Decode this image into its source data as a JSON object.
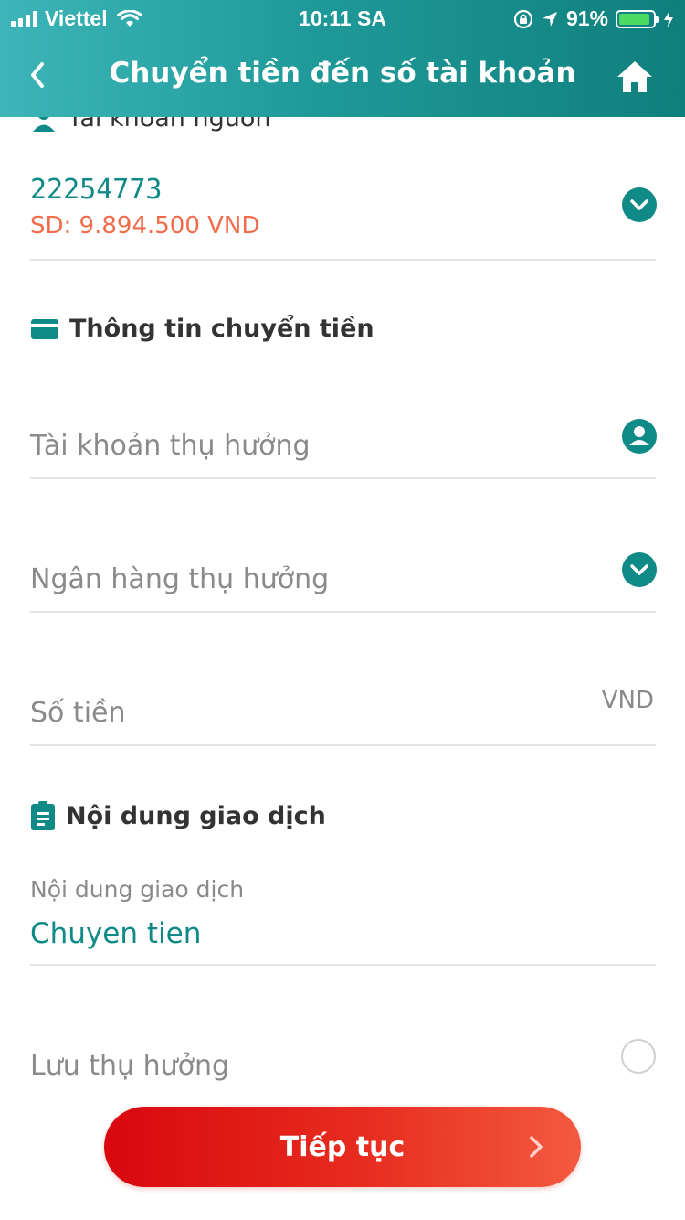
{
  "status_bar": {
    "carrier": "Viettel",
    "time": "10:11 SA",
    "battery_percent": "91%",
    "battery_level": 0.91
  },
  "nav": {
    "title": "Chuyển tiền đến số tài khoản",
    "icons": {
      "back": "chevron-left-icon",
      "home": "home-icon"
    }
  },
  "source": {
    "section_label": "Tài khoản nguồn",
    "account_number": "22254773",
    "balance": "SD: 9.894.500  VND"
  },
  "transfer_info": {
    "section_label": "Thông tin chuyển tiền",
    "beneficiary_account_placeholder": "Tài khoản thụ hưởng",
    "beneficiary_bank_placeholder": "Ngân hàng thụ hưởng",
    "amount_placeholder": "Số tiền",
    "amount_unit": "VND"
  },
  "transaction_content": {
    "section_label": "Nội dung giao dịch",
    "field_label": "Nội dung giao dịch",
    "value": "Chuyen tien"
  },
  "save_beneficiary": {
    "label": "Lưu thụ hưởng",
    "checked": false
  },
  "continue_button": {
    "label": "Tiếp tục"
  },
  "colors": {
    "accent": "#0f8a87",
    "balance": "#f26b4b",
    "button": "#e22a1d"
  }
}
